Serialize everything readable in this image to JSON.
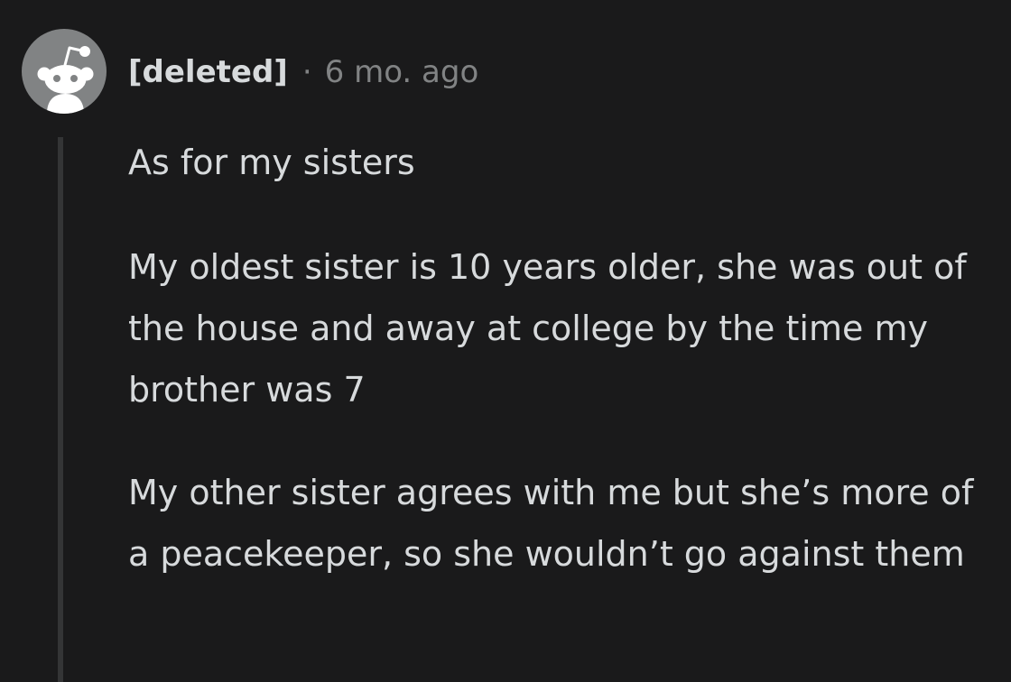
{
  "comment": {
    "author": "[deleted]",
    "separator": "·",
    "timestamp": "6 mo. ago",
    "avatar_icon": "snoo-avatar-icon",
    "paragraphs": [
      "As for my sisters",
      "My oldest sister is 10 years older, she was out of the house and away at college by the time my brother was 7",
      "My other sister agrees with me but she’s more of a peacekeeper, so she wouldn’t go against them"
    ]
  },
  "colors": {
    "background": "#1a1a1b",
    "text": "#d7dadc",
    "meta": "#818384",
    "avatar_bg": "#818384",
    "thread_line": "#343536"
  }
}
